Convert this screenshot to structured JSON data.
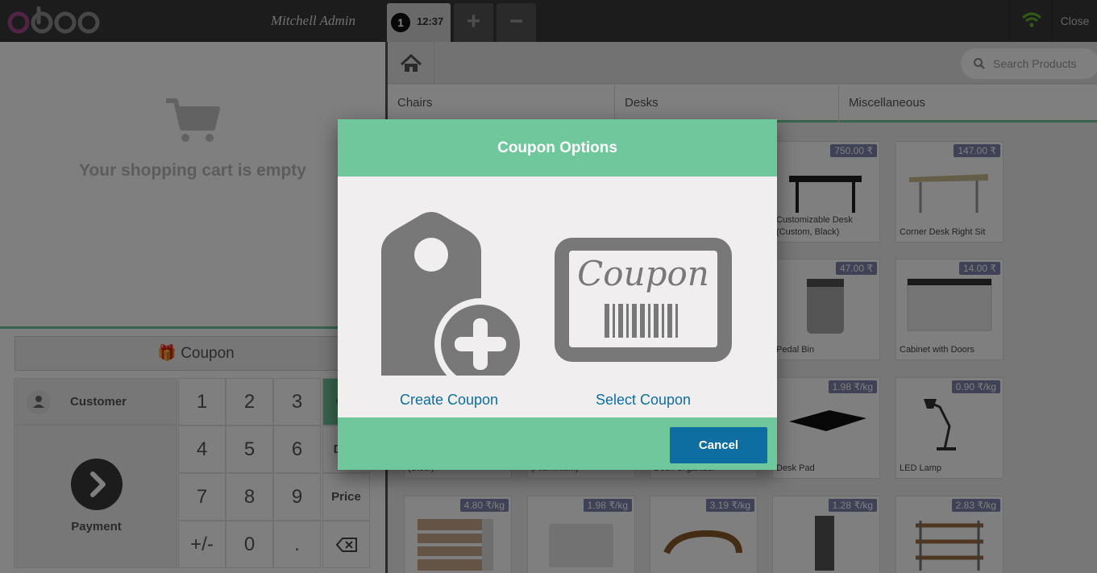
{
  "header": {
    "user_name": "Mitchell Admin",
    "order_number": "1",
    "order_time": "12:37",
    "add_order_label": "+",
    "remove_order_label": "−",
    "close_label": "Close"
  },
  "cart": {
    "empty_message": "Your shopping cart is empty",
    "coupon_button_label": "Coupon"
  },
  "pad": {
    "customer_label": "Customer",
    "payment_label": "Payment",
    "keys": [
      "1",
      "2",
      "3",
      "4",
      "5",
      "6",
      "7",
      "8",
      "9",
      "+/-",
      "0",
      "."
    ],
    "qty_label": "Qty",
    "disc_label": "Disc",
    "price_label": "Price"
  },
  "products_screen": {
    "search_placeholder": "Search Products",
    "categories": [
      "Chairs",
      "Desks",
      "Miscellaneous"
    ],
    "products": [
      {
        "name": "Customizable Desk (Custom, Black)",
        "price": "750.00 ₹"
      },
      {
        "name": "Corner Desk Right Sit",
        "price": "147.00 ₹"
      },
      {
        "name": "Pedal Bin",
        "price": "47.00 ₹"
      },
      {
        "name": "Cabinet with Doors",
        "price": "14.00 ₹"
      },
      {
        "name": "(Steel)",
        "price": ""
      },
      {
        "name": "(Aluminium)",
        "price": ""
      },
      {
        "name": "Desk Organizer",
        "price": ""
      },
      {
        "name": "Desk Pad",
        "price": "1.98 ₹/kg"
      },
      {
        "name": "LED Lamp",
        "price": "0.90 ₹/kg"
      },
      {
        "name": "",
        "price": "4.80 ₹/kg"
      },
      {
        "name": "",
        "price": "1.98 ₹/kg"
      },
      {
        "name": "",
        "price": "3.19 ₹/kg"
      },
      {
        "name": "",
        "price": "1.28 ₹/kg"
      },
      {
        "name": "",
        "price": "2.83 ₹/kg"
      }
    ]
  },
  "modal": {
    "title": "Coupon Options",
    "create_label": "Create Coupon",
    "select_label": "Select Coupon",
    "coupon_card_text": "Coupon",
    "cancel_label": "Cancel"
  },
  "colors": {
    "accent_green": "#6ec89b",
    "link_blue": "#0e6ea1",
    "header_dark": "#393939",
    "price_tag": "#7f82ac"
  }
}
